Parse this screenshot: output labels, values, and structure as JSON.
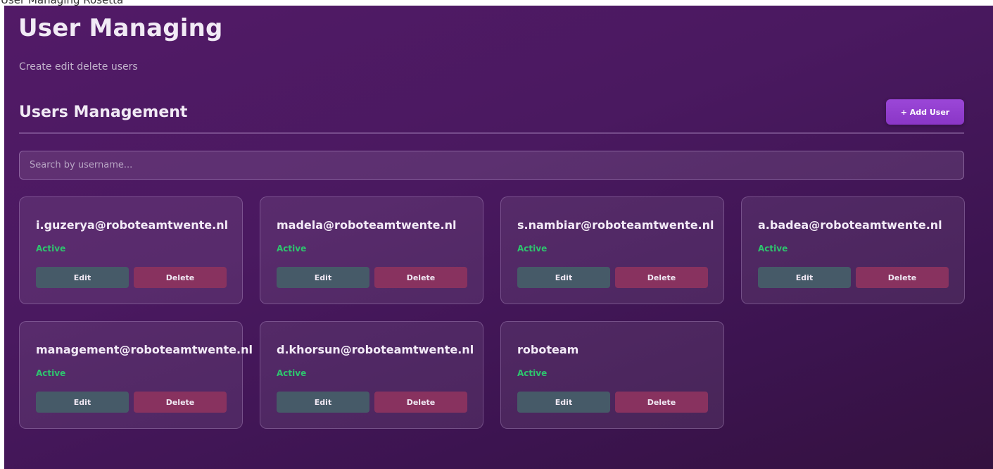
{
  "top_strip": {
    "text": "User Managing Rosetta"
  },
  "header": {
    "title": "User Managing",
    "subtitle": "Create edit delete users"
  },
  "section": {
    "title": "Users Management",
    "add_button_label": "+ Add User"
  },
  "search": {
    "placeholder": "Search by username...",
    "value": ""
  },
  "card_actions": {
    "edit_label": "Edit",
    "delete_label": "Delete"
  },
  "users": [
    {
      "username": "i.guzerya@roboteamtwente.nl",
      "status": "Active"
    },
    {
      "username": "madela@roboteamtwente.nl",
      "status": "Active"
    },
    {
      "username": "s.nambiar@roboteamtwente.nl",
      "status": "Active"
    },
    {
      "username": "a.badea@roboteamtwente.nl",
      "status": "Active"
    },
    {
      "username": "management@roboteamtwente.nl",
      "status": "Active"
    },
    {
      "username": "d.khorsun@roboteamtwente.nl",
      "status": "Active"
    },
    {
      "username": "roboteam",
      "status": "Active"
    }
  ],
  "colors": {
    "background": "#4a1960",
    "accent": "#9b47d8",
    "status_active": "#2ec46e",
    "edit_button": "#465a68",
    "delete_button": "#88325f"
  }
}
